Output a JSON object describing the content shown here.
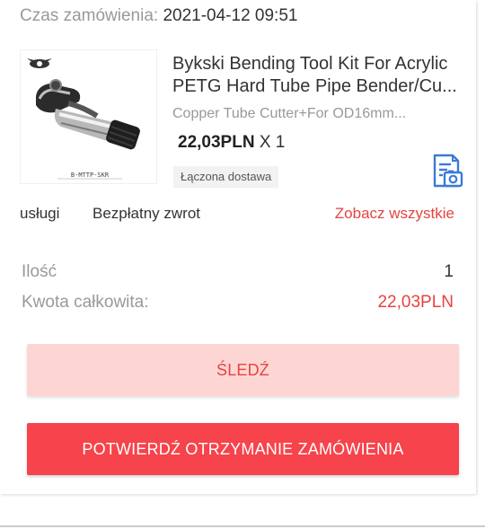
{
  "order": {
    "time_label": "Czas zamówienia:",
    "time_value": "2021-04-12 09:51"
  },
  "product": {
    "image_icon": "pipe-cutter-tool-image",
    "image_caption": "B-MTTP-SKR",
    "title": "Bykski Bending Tool Kit For Acrylic PETG Hard Tube Pipe Bender/Cu...",
    "sku": "Copper Tube Cutter+For OD16mm...",
    "price": "22,03PLN",
    "quantity_text": "X 1",
    "shipping_tag": "Łączona dostawa",
    "receipt_icon": "receipt-icon"
  },
  "services": {
    "label": "usługi",
    "value": "Bezpłatny zwrot",
    "see_all": "Zobacz wszystkie"
  },
  "summary": {
    "quantity_label": "Ilość",
    "quantity_value": "1",
    "total_label": "Kwota całkowita:",
    "total_value": "22,03PLN"
  },
  "buttons": {
    "track": "ŚLEDŹ",
    "confirm": "POTWIERDŹ OTRZYMANIE ZAMÓWIENIA"
  },
  "colors": {
    "accent": "#e64340",
    "confirm_bg": "#f7434b",
    "track_bg": "#fdd6d4",
    "muted_text": "#999999",
    "icon_blue": "#3a7bd5"
  }
}
